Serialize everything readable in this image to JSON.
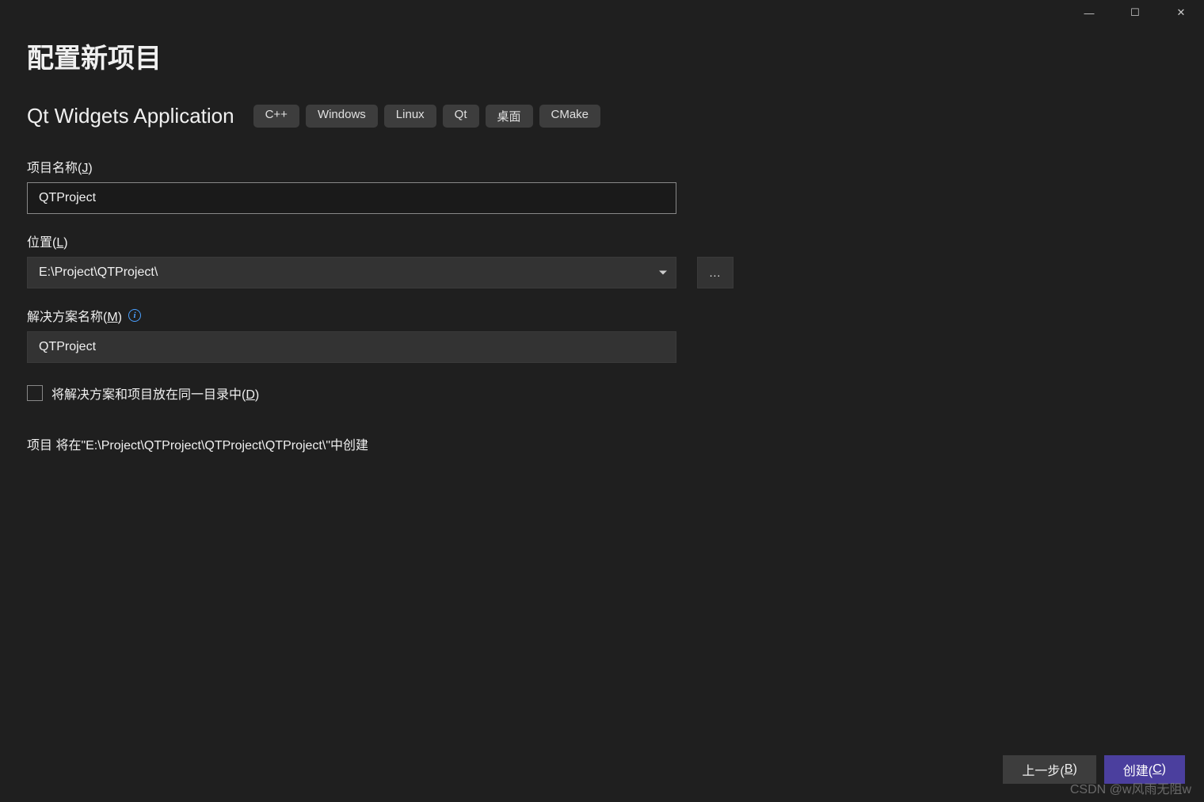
{
  "window": {
    "minimize": "—",
    "maximize": "☐",
    "close": "✕"
  },
  "page_title": "配置新项目",
  "template_name": "Qt Widgets Application",
  "tags": [
    "C++",
    "Windows",
    "Linux",
    "Qt",
    "桌面",
    "CMake"
  ],
  "fields": {
    "project_name": {
      "label_prefix": "项目名称(",
      "label_key": "J",
      "label_suffix": ")",
      "value": "QTProject"
    },
    "location": {
      "label_prefix": "位置(",
      "label_key": "L",
      "label_suffix": ")",
      "value": "E:\\Project\\QTProject\\",
      "browse": "..."
    },
    "solution_name": {
      "label_prefix": "解决方案名称(",
      "label_key": "M",
      "label_suffix": ")",
      "value": "QTProject",
      "info": "i"
    },
    "same_dir": {
      "label_prefix": "将解决方案和项目放在同一目录中(",
      "label_key": "D",
      "label_suffix": ")",
      "checked": false
    }
  },
  "summary": "项目 将在\"E:\\Project\\QTProject\\QTProject\\QTProject\\\"中创建",
  "footer": {
    "back_prefix": "上一步(",
    "back_key": "B",
    "back_suffix": ")",
    "create_prefix": "创建(",
    "create_key": "C",
    "create_suffix": ")"
  },
  "watermark": "CSDN @w风雨无阻w"
}
